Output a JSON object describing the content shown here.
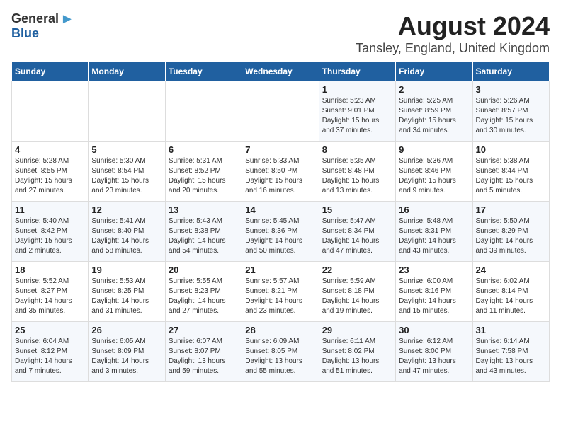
{
  "logo": {
    "general": "General",
    "blue": "Blue"
  },
  "title": "August 2024",
  "location": "Tansley, England, United Kingdom",
  "weekdays": [
    "Sunday",
    "Monday",
    "Tuesday",
    "Wednesday",
    "Thursday",
    "Friday",
    "Saturday"
  ],
  "weeks": [
    [
      {
        "day": "",
        "sunrise": "",
        "sunset": "",
        "daylight": ""
      },
      {
        "day": "",
        "sunrise": "",
        "sunset": "",
        "daylight": ""
      },
      {
        "day": "",
        "sunrise": "",
        "sunset": "",
        "daylight": ""
      },
      {
        "day": "",
        "sunrise": "",
        "sunset": "",
        "daylight": ""
      },
      {
        "day": "1",
        "sunrise": "Sunrise: 5:23 AM",
        "sunset": "Sunset: 9:01 PM",
        "daylight": "Daylight: 15 hours and 37 minutes."
      },
      {
        "day": "2",
        "sunrise": "Sunrise: 5:25 AM",
        "sunset": "Sunset: 8:59 PM",
        "daylight": "Daylight: 15 hours and 34 minutes."
      },
      {
        "day": "3",
        "sunrise": "Sunrise: 5:26 AM",
        "sunset": "Sunset: 8:57 PM",
        "daylight": "Daylight: 15 hours and 30 minutes."
      }
    ],
    [
      {
        "day": "4",
        "sunrise": "Sunrise: 5:28 AM",
        "sunset": "Sunset: 8:55 PM",
        "daylight": "Daylight: 15 hours and 27 minutes."
      },
      {
        "day": "5",
        "sunrise": "Sunrise: 5:30 AM",
        "sunset": "Sunset: 8:54 PM",
        "daylight": "Daylight: 15 hours and 23 minutes."
      },
      {
        "day": "6",
        "sunrise": "Sunrise: 5:31 AM",
        "sunset": "Sunset: 8:52 PM",
        "daylight": "Daylight: 15 hours and 20 minutes."
      },
      {
        "day": "7",
        "sunrise": "Sunrise: 5:33 AM",
        "sunset": "Sunset: 8:50 PM",
        "daylight": "Daylight: 15 hours and 16 minutes."
      },
      {
        "day": "8",
        "sunrise": "Sunrise: 5:35 AM",
        "sunset": "Sunset: 8:48 PM",
        "daylight": "Daylight: 15 hours and 13 minutes."
      },
      {
        "day": "9",
        "sunrise": "Sunrise: 5:36 AM",
        "sunset": "Sunset: 8:46 PM",
        "daylight": "Daylight: 15 hours and 9 minutes."
      },
      {
        "day": "10",
        "sunrise": "Sunrise: 5:38 AM",
        "sunset": "Sunset: 8:44 PM",
        "daylight": "Daylight: 15 hours and 5 minutes."
      }
    ],
    [
      {
        "day": "11",
        "sunrise": "Sunrise: 5:40 AM",
        "sunset": "Sunset: 8:42 PM",
        "daylight": "Daylight: 15 hours and 2 minutes."
      },
      {
        "day": "12",
        "sunrise": "Sunrise: 5:41 AM",
        "sunset": "Sunset: 8:40 PM",
        "daylight": "Daylight: 14 hours and 58 minutes."
      },
      {
        "day": "13",
        "sunrise": "Sunrise: 5:43 AM",
        "sunset": "Sunset: 8:38 PM",
        "daylight": "Daylight: 14 hours and 54 minutes."
      },
      {
        "day": "14",
        "sunrise": "Sunrise: 5:45 AM",
        "sunset": "Sunset: 8:36 PM",
        "daylight": "Daylight: 14 hours and 50 minutes."
      },
      {
        "day": "15",
        "sunrise": "Sunrise: 5:47 AM",
        "sunset": "Sunset: 8:34 PM",
        "daylight": "Daylight: 14 hours and 47 minutes."
      },
      {
        "day": "16",
        "sunrise": "Sunrise: 5:48 AM",
        "sunset": "Sunset: 8:31 PM",
        "daylight": "Daylight: 14 hours and 43 minutes."
      },
      {
        "day": "17",
        "sunrise": "Sunrise: 5:50 AM",
        "sunset": "Sunset: 8:29 PM",
        "daylight": "Daylight: 14 hours and 39 minutes."
      }
    ],
    [
      {
        "day": "18",
        "sunrise": "Sunrise: 5:52 AM",
        "sunset": "Sunset: 8:27 PM",
        "daylight": "Daylight: 14 hours and 35 minutes."
      },
      {
        "day": "19",
        "sunrise": "Sunrise: 5:53 AM",
        "sunset": "Sunset: 8:25 PM",
        "daylight": "Daylight: 14 hours and 31 minutes."
      },
      {
        "day": "20",
        "sunrise": "Sunrise: 5:55 AM",
        "sunset": "Sunset: 8:23 PM",
        "daylight": "Daylight: 14 hours and 27 minutes."
      },
      {
        "day": "21",
        "sunrise": "Sunrise: 5:57 AM",
        "sunset": "Sunset: 8:21 PM",
        "daylight": "Daylight: 14 hours and 23 minutes."
      },
      {
        "day": "22",
        "sunrise": "Sunrise: 5:59 AM",
        "sunset": "Sunset: 8:18 PM",
        "daylight": "Daylight: 14 hours and 19 minutes."
      },
      {
        "day": "23",
        "sunrise": "Sunrise: 6:00 AM",
        "sunset": "Sunset: 8:16 PM",
        "daylight": "Daylight: 14 hours and 15 minutes."
      },
      {
        "day": "24",
        "sunrise": "Sunrise: 6:02 AM",
        "sunset": "Sunset: 8:14 PM",
        "daylight": "Daylight: 14 hours and 11 minutes."
      }
    ],
    [
      {
        "day": "25",
        "sunrise": "Sunrise: 6:04 AM",
        "sunset": "Sunset: 8:12 PM",
        "daylight": "Daylight: 14 hours and 7 minutes."
      },
      {
        "day": "26",
        "sunrise": "Sunrise: 6:05 AM",
        "sunset": "Sunset: 8:09 PM",
        "daylight": "Daylight: 14 hours and 3 minutes."
      },
      {
        "day": "27",
        "sunrise": "Sunrise: 6:07 AM",
        "sunset": "Sunset: 8:07 PM",
        "daylight": "Daylight: 13 hours and 59 minutes."
      },
      {
        "day": "28",
        "sunrise": "Sunrise: 6:09 AM",
        "sunset": "Sunset: 8:05 PM",
        "daylight": "Daylight: 13 hours and 55 minutes."
      },
      {
        "day": "29",
        "sunrise": "Sunrise: 6:11 AM",
        "sunset": "Sunset: 8:02 PM",
        "daylight": "Daylight: 13 hours and 51 minutes."
      },
      {
        "day": "30",
        "sunrise": "Sunrise: 6:12 AM",
        "sunset": "Sunset: 8:00 PM",
        "daylight": "Daylight: 13 hours and 47 minutes."
      },
      {
        "day": "31",
        "sunrise": "Sunrise: 6:14 AM",
        "sunset": "Sunset: 7:58 PM",
        "daylight": "Daylight: 13 hours and 43 minutes."
      }
    ]
  ]
}
